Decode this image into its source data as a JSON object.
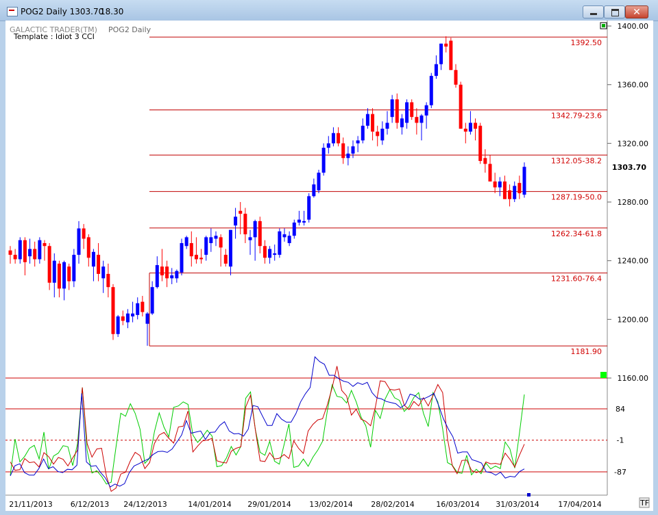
{
  "window": {
    "title": "POG2 Daily 1303.70",
    "title_extra": "18.30"
  },
  "header": {
    "app_label": "GALACTIC TRADER(TM)",
    "symbol_label": "POG2 Daily",
    "template_label": "Template : Idiot 3 CCI"
  },
  "colors": {
    "up_candle": "#0000ff",
    "down_candle": "#ff0000",
    "level_line": "#c00000",
    "cci_green": "#00cc00",
    "cci_red": "#cc0000",
    "cci_blue": "#0000cc",
    "marker_green": "#00ff00"
  },
  "price_axis": {
    "ticks": [
      "1400.00",
      "1360.00",
      "1320.00",
      "1280.00",
      "1240.00",
      "1200.00",
      "1160.00"
    ],
    "current_price": "1303.70"
  },
  "retracement_levels": [
    {
      "value": 1392.5,
      "label": "1392.50"
    },
    {
      "value": 1342.79,
      "label": "1342.79-23.6"
    },
    {
      "value": 1312.05,
      "label": "1312.05-38.2"
    },
    {
      "value": 1287.19,
      "label": "1287.19-50.0"
    },
    {
      "value": 1262.34,
      "label": "1262.34-61.8"
    },
    {
      "value": 1231.6,
      "label": "1231.60-76.4"
    },
    {
      "value": 1181.9,
      "label": "1181.90"
    }
  ],
  "cci_axis": {
    "ticks": [
      "84",
      "-1",
      "-87"
    ]
  },
  "date_axis": {
    "labels": [
      "21/11/2013",
      "6/12/2013",
      "24/12/2013",
      "14/01/2014",
      "29/01/2014",
      "13/02/2014",
      "28/02/2014",
      "16/03/2014",
      "31/03/2014",
      "17/04/2014"
    ]
  },
  "corner_button": "TF",
  "chart_data": {
    "type": "candlestick",
    "title": "POG2 Daily",
    "ylim": [
      1150,
      1405
    ],
    "candles": [
      {
        "o": 1247,
        "h": 1250,
        "l": 1238,
        "c": 1244
      },
      {
        "o": 1244,
        "h": 1248,
        "l": 1238,
        "c": 1241
      },
      {
        "o": 1241,
        "h": 1256,
        "l": 1238,
        "c": 1254
      },
      {
        "o": 1254,
        "h": 1256,
        "l": 1230,
        "c": 1239
      },
      {
        "o": 1243,
        "h": 1255,
        "l": 1238,
        "c": 1248
      },
      {
        "o": 1248,
        "h": 1253,
        "l": 1236,
        "c": 1241
      },
      {
        "o": 1241,
        "h": 1256,
        "l": 1238,
        "c": 1254
      },
      {
        "o": 1252,
        "h": 1254,
        "l": 1240,
        "c": 1250
      },
      {
        "o": 1250,
        "h": 1252,
        "l": 1220,
        "c": 1225
      },
      {
        "o": 1225,
        "h": 1245,
        "l": 1215,
        "c": 1240
      },
      {
        "o": 1238,
        "h": 1240,
        "l": 1215,
        "c": 1221
      },
      {
        "o": 1221,
        "h": 1240,
        "l": 1213,
        "c": 1239
      },
      {
        "o": 1236,
        "h": 1238,
        "l": 1220,
        "c": 1226
      },
      {
        "o": 1226,
        "h": 1248,
        "l": 1222,
        "c": 1244
      },
      {
        "o": 1244,
        "h": 1267,
        "l": 1238,
        "c": 1262
      },
      {
        "o": 1262,
        "h": 1265,
        "l": 1248,
        "c": 1255
      },
      {
        "o": 1256,
        "h": 1258,
        "l": 1236,
        "c": 1242
      },
      {
        "o": 1236,
        "h": 1248,
        "l": 1226,
        "c": 1246
      },
      {
        "o": 1244,
        "h": 1252,
        "l": 1226,
        "c": 1231
      },
      {
        "o": 1228,
        "h": 1240,
        "l": 1218,
        "c": 1236
      },
      {
        "o": 1231,
        "h": 1238,
        "l": 1215,
        "c": 1222
      },
      {
        "o": 1222,
        "h": 1224,
        "l": 1186,
        "c": 1190
      },
      {
        "o": 1190,
        "h": 1203,
        "l": 1188,
        "c": 1202
      },
      {
        "o": 1202,
        "h": 1206,
        "l": 1196,
        "c": 1199
      },
      {
        "o": 1198,
        "h": 1207,
        "l": 1194,
        "c": 1204
      },
      {
        "o": 1202,
        "h": 1212,
        "l": 1198,
        "c": 1204
      },
      {
        "o": 1203,
        "h": 1215,
        "l": 1200,
        "c": 1211
      },
      {
        "o": 1212,
        "h": 1216,
        "l": 1202,
        "c": 1205
      },
      {
        "o": 1197,
        "h": 1205,
        "l": 1182,
        "c": 1204
      },
      {
        "o": 1204,
        "h": 1226,
        "l": 1203,
        "c": 1222
      },
      {
        "o": 1222,
        "h": 1243,
        "l": 1221,
        "c": 1237
      },
      {
        "o": 1236,
        "h": 1248,
        "l": 1226,
        "c": 1230
      },
      {
        "o": 1236,
        "h": 1240,
        "l": 1222,
        "c": 1228
      },
      {
        "o": 1228,
        "h": 1235,
        "l": 1224,
        "c": 1230
      },
      {
        "o": 1228,
        "h": 1234,
        "l": 1225,
        "c": 1233
      },
      {
        "o": 1232,
        "h": 1255,
        "l": 1230,
        "c": 1252
      },
      {
        "o": 1250,
        "h": 1257,
        "l": 1248,
        "c": 1256
      },
      {
        "o": 1252,
        "h": 1260,
        "l": 1236,
        "c": 1243
      },
      {
        "o": 1244,
        "h": 1256,
        "l": 1238,
        "c": 1241
      },
      {
        "o": 1242,
        "h": 1248,
        "l": 1238,
        "c": 1241
      },
      {
        "o": 1244,
        "h": 1257,
        "l": 1240,
        "c": 1256
      },
      {
        "o": 1252,
        "h": 1262,
        "l": 1246,
        "c": 1256
      },
      {
        "o": 1255,
        "h": 1260,
        "l": 1250,
        "c": 1257
      },
      {
        "o": 1256,
        "h": 1258,
        "l": 1236,
        "c": 1249
      },
      {
        "o": 1244,
        "h": 1248,
        "l": 1236,
        "c": 1238
      },
      {
        "o": 1236,
        "h": 1261,
        "l": 1230,
        "c": 1261
      },
      {
        "o": 1264,
        "h": 1276,
        "l": 1255,
        "c": 1270
      },
      {
        "o": 1274,
        "h": 1280,
        "l": 1258,
        "c": 1272
      },
      {
        "o": 1272,
        "h": 1276,
        "l": 1252,
        "c": 1258
      },
      {
        "o": 1254,
        "h": 1261,
        "l": 1244,
        "c": 1256
      },
      {
        "o": 1256,
        "h": 1268,
        "l": 1240,
        "c": 1267
      },
      {
        "o": 1267,
        "h": 1270,
        "l": 1245,
        "c": 1250
      },
      {
        "o": 1250,
        "h": 1254,
        "l": 1238,
        "c": 1242
      },
      {
        "o": 1242,
        "h": 1250,
        "l": 1238,
        "c": 1248
      },
      {
        "o": 1244,
        "h": 1251,
        "l": 1240,
        "c": 1245
      },
      {
        "o": 1244,
        "h": 1262,
        "l": 1242,
        "c": 1260
      },
      {
        "o": 1256,
        "h": 1262,
        "l": 1253,
        "c": 1258
      },
      {
        "o": 1252,
        "h": 1260,
        "l": 1250,
        "c": 1257
      },
      {
        "o": 1257,
        "h": 1268,
        "l": 1255,
        "c": 1266
      },
      {
        "o": 1266,
        "h": 1274,
        "l": 1264,
        "c": 1268
      },
      {
        "o": 1266,
        "h": 1274,
        "l": 1264,
        "c": 1267
      },
      {
        "o": 1268,
        "h": 1286,
        "l": 1266,
        "c": 1284
      },
      {
        "o": 1284,
        "h": 1296,
        "l": 1283,
        "c": 1292
      },
      {
        "o": 1288,
        "h": 1302,
        "l": 1286,
        "c": 1300
      },
      {
        "o": 1300,
        "h": 1320,
        "l": 1298,
        "c": 1317
      },
      {
        "o": 1317,
        "h": 1325,
        "l": 1313,
        "c": 1320
      },
      {
        "o": 1320,
        "h": 1331,
        "l": 1318,
        "c": 1327
      },
      {
        "o": 1327,
        "h": 1331,
        "l": 1318,
        "c": 1320
      },
      {
        "o": 1320,
        "h": 1324,
        "l": 1306,
        "c": 1310
      },
      {
        "o": 1310,
        "h": 1318,
        "l": 1305,
        "c": 1313
      },
      {
        "o": 1313,
        "h": 1322,
        "l": 1310,
        "c": 1318
      },
      {
        "o": 1320,
        "h": 1325,
        "l": 1314,
        "c": 1322
      },
      {
        "o": 1322,
        "h": 1337,
        "l": 1320,
        "c": 1332
      },
      {
        "o": 1332,
        "h": 1344,
        "l": 1330,
        "c": 1340
      },
      {
        "o": 1340,
        "h": 1344,
        "l": 1322,
        "c": 1328
      },
      {
        "o": 1328,
        "h": 1332,
        "l": 1318,
        "c": 1325
      },
      {
        "o": 1322,
        "h": 1335,
        "l": 1319,
        "c": 1330
      },
      {
        "o": 1330,
        "h": 1342,
        "l": 1326,
        "c": 1334
      },
      {
        "o": 1338,
        "h": 1353,
        "l": 1334,
        "c": 1350
      },
      {
        "o": 1350,
        "h": 1354,
        "l": 1330,
        "c": 1334
      },
      {
        "o": 1331,
        "h": 1340,
        "l": 1326,
        "c": 1337
      },
      {
        "o": 1334,
        "h": 1350,
        "l": 1330,
        "c": 1348
      },
      {
        "o": 1348,
        "h": 1350,
        "l": 1336,
        "c": 1338
      },
      {
        "o": 1338,
        "h": 1344,
        "l": 1326,
        "c": 1334
      },
      {
        "o": 1334,
        "h": 1340,
        "l": 1322,
        "c": 1339
      },
      {
        "o": 1339,
        "h": 1348,
        "l": 1330,
        "c": 1346
      },
      {
        "o": 1346,
        "h": 1368,
        "l": 1344,
        "c": 1366
      },
      {
        "o": 1366,
        "h": 1380,
        "l": 1364,
        "c": 1374
      },
      {
        "o": 1374,
        "h": 1388,
        "l": 1370,
        "c": 1388
      },
      {
        "o": 1388,
        "h": 1393,
        "l": 1382,
        "c": 1386
      },
      {
        "o": 1390,
        "h": 1392,
        "l": 1370,
        "c": 1370
      },
      {
        "o": 1370,
        "h": 1374,
        "l": 1358,
        "c": 1360
      },
      {
        "o": 1360,
        "h": 1362,
        "l": 1330,
        "c": 1330
      },
      {
        "o": 1330,
        "h": 1334,
        "l": 1320,
        "c": 1328
      },
      {
        "o": 1328,
        "h": 1342,
        "l": 1326,
        "c": 1334
      },
      {
        "o": 1334,
        "h": 1337,
        "l": 1322,
        "c": 1330
      },
      {
        "o": 1332,
        "h": 1334,
        "l": 1306,
        "c": 1308
      },
      {
        "o": 1310,
        "h": 1316,
        "l": 1300,
        "c": 1306
      },
      {
        "o": 1306,
        "h": 1312,
        "l": 1294,
        "c": 1294
      },
      {
        "o": 1294,
        "h": 1300,
        "l": 1286,
        "c": 1290
      },
      {
        "o": 1290,
        "h": 1297,
        "l": 1284,
        "c": 1294
      },
      {
        "o": 1294,
        "h": 1298,
        "l": 1283,
        "c": 1282
      },
      {
        "o": 1288,
        "h": 1292,
        "l": 1277,
        "c": 1282
      },
      {
        "o": 1282,
        "h": 1294,
        "l": 1280,
        "c": 1291
      },
      {
        "o": 1293,
        "h": 1298,
        "l": 1282,
        "c": 1286
      },
      {
        "o": 1285,
        "h": 1307,
        "l": 1283,
        "c": 1304
      }
    ],
    "cci_series": [
      {
        "name": "green",
        "values": [
          -96,
          2,
          -60,
          -45,
          -23,
          -15,
          -52,
          21,
          -80,
          -44,
          -36,
          -16,
          -19,
          -70,
          -10,
          142,
          -29,
          -90,
          -84,
          -99,
          -120,
          -115,
          -20,
          72,
          64,
          98,
          72,
          29,
          -64,
          -50,
          22,
          73,
          34,
          8,
          88,
          92,
          103,
          96,
          13,
          -7,
          8,
          26,
          10,
          -73,
          -70,
          -49,
          -18,
          -41,
          -18,
          113,
          130,
          28,
          -34,
          -42,
          -4,
          -58,
          -66,
          -13,
          43,
          -75,
          -71,
          -52,
          -72,
          -47,
          -28,
          -4,
          79,
          149,
          118,
          115,
          100,
          134,
          103,
          62,
          38,
          -20,
          80,
          58,
          110,
          136,
          114,
          107,
          77,
          90,
          115,
          128,
          72,
          36,
          128,
          103,
          30,
          -62,
          -69,
          -88,
          -91,
          -42,
          -95,
          -80,
          -92,
          -63,
          -79,
          -71,
          -78,
          -6,
          -25,
          -77,
          20,
          123
        ]
      },
      {
        "name": "red",
        "values": [
          -60,
          -83,
          -81,
          -51,
          -62,
          -60,
          -74,
          -35,
          -46,
          -66,
          -48,
          -53,
          -71,
          -49,
          -28,
          142,
          -10,
          -47,
          -25,
          -23,
          -98,
          -140,
          -131,
          -93,
          -88,
          -57,
          -34,
          -43,
          -78,
          -62,
          -10,
          13,
          20,
          4,
          -9,
          35,
          37,
          78,
          -33,
          -17,
          -3,
          -1,
          4,
          -57,
          -61,
          -63,
          -31,
          -23,
          -19,
          89,
          121,
          28,
          -57,
          -59,
          -35,
          -52,
          -50,
          -40,
          -51,
          -3,
          -23,
          -37,
          24,
          42,
          54,
          57,
          95,
          141,
          200,
          134,
          119,
          67,
          83,
          56,
          50,
          38,
          89,
          160,
          158,
          137,
          135,
          138,
          94,
          82,
          104,
          92,
          114,
          92,
          120,
          150,
          128,
          3,
          -70,
          -92,
          -56,
          -55,
          -83,
          -89,
          -85,
          -60,
          -65,
          -64,
          -67,
          -36,
          -53,
          -74,
          -41,
          -12
        ]
      },
      {
        "name": "blue",
        "values": [
          -98,
          -70,
          -65,
          -89,
          -96,
          -96,
          -78,
          -52,
          -78,
          -73,
          -86,
          -89,
          -80,
          -81,
          -69,
          126,
          -60,
          -72,
          -70,
          -89,
          -104,
          -128,
          -120,
          -126,
          -119,
          -89,
          -71,
          -65,
          -58,
          -52,
          -40,
          -32,
          -31,
          -34,
          -25,
          -6,
          13,
          52,
          18,
          21,
          24,
          1,
          20,
          21,
          39,
          49,
          24,
          16,
          17,
          10,
          29,
          93,
          90,
          64,
          39,
          39,
          71,
          56,
          48,
          48,
          71,
          103,
          125,
          142,
          225,
          212,
          205,
          175,
          175,
          166,
          159,
          156,
          145,
          155,
          150,
          156,
          128,
          114,
          111,
          104,
          101,
          98,
          87,
          96,
          124,
          120,
          110,
          112,
          118,
          126,
          93,
          57,
          30,
          8,
          -36,
          -33,
          -33,
          -54,
          -58,
          -63,
          -87,
          -89,
          -96,
          -88,
          -104,
          -99,
          -101,
          -86,
          -79
        ]
      }
    ]
  }
}
